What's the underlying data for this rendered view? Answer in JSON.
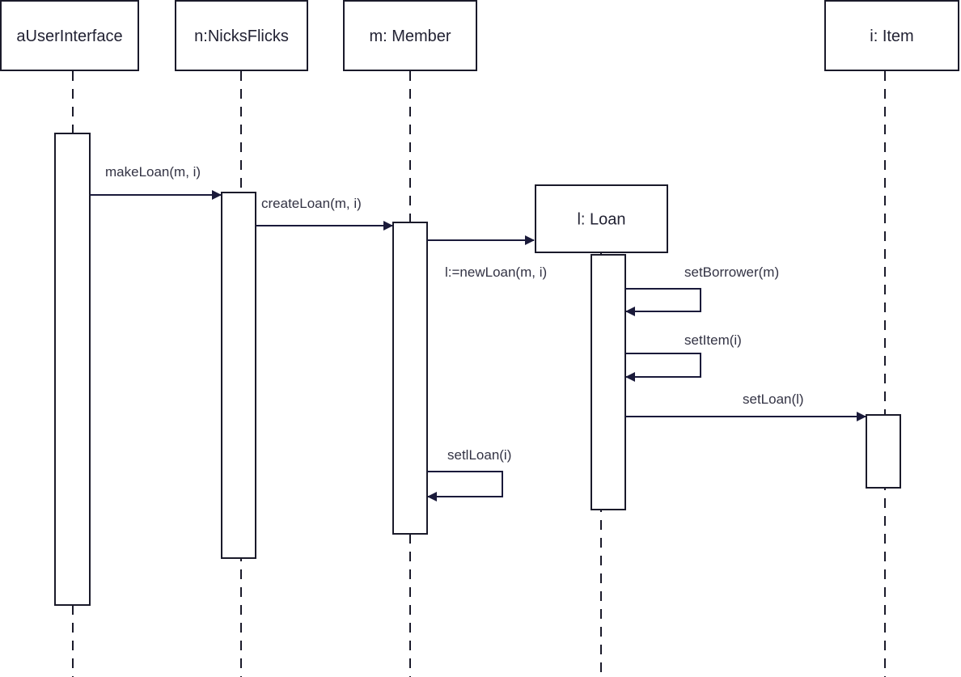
{
  "participants": [
    {
      "name": "aUserInterface"
    },
    {
      "name": "n:NicksFlicks"
    },
    {
      "name": "m: Member"
    },
    {
      "name": "l: Loan"
    },
    {
      "name": "i: Item"
    }
  ],
  "messages": [
    {
      "label": "makeLoan(m, i)",
      "from": "aUserInterface",
      "to": "n:NicksFlicks"
    },
    {
      "label": "createLoan(m, i)",
      "from": "n:NicksFlicks",
      "to": "m: Member"
    },
    {
      "label": "l:=newLoan(m, i)",
      "from": "m: Member",
      "to": "l: Loan"
    },
    {
      "label": "setBorrower(m)",
      "from": "l: Loan",
      "to": "l: Loan"
    },
    {
      "label": "setItem(i)",
      "from": "l: Loan",
      "to": "l: Loan"
    },
    {
      "label": "setLoan(l)",
      "from": "l: Loan",
      "to": "i: Item"
    },
    {
      "label": "setlLoan(i)",
      "from": "m: Member",
      "to": "m: Member"
    }
  ]
}
